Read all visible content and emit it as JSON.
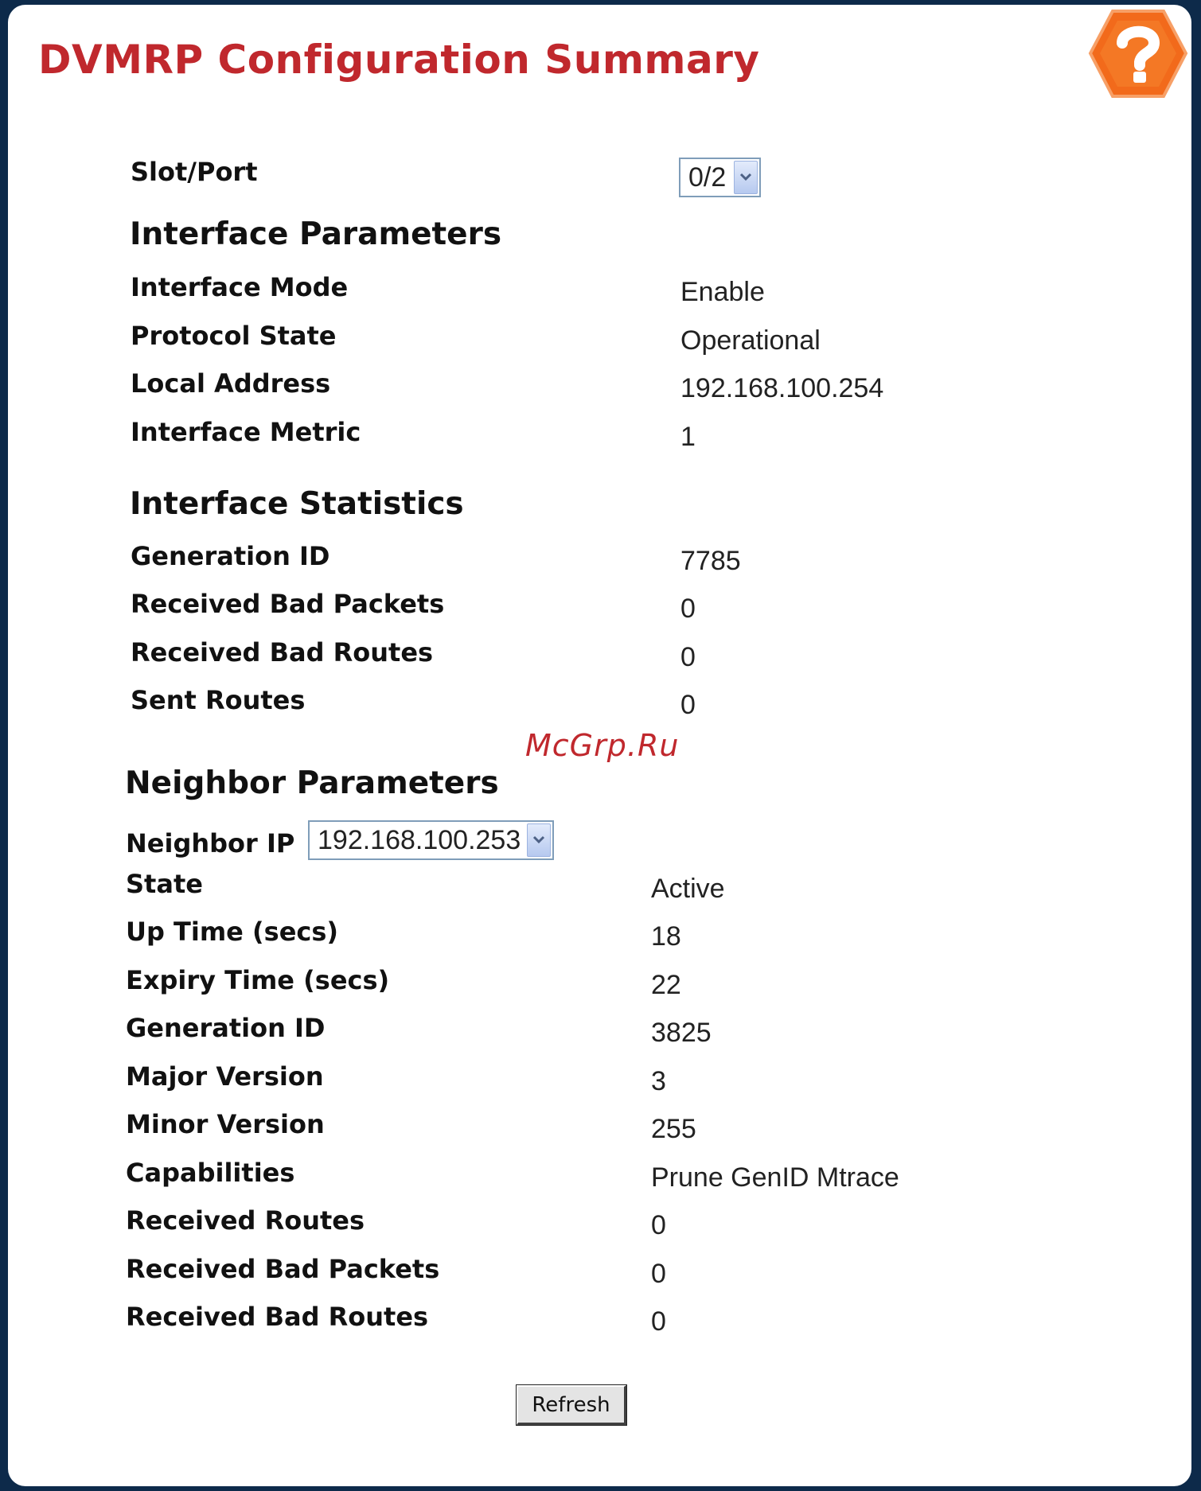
{
  "page": {
    "title": "DVMRP Configuration Summary"
  },
  "colors": {
    "title": "#c0282d",
    "help_icon": "#f26a1b",
    "frame": "#0d2a4a"
  },
  "icons": {
    "help": "question-mark-hexagon-icon",
    "dropdown": "chevron-down-icon"
  },
  "slot_port": {
    "label": "Slot/Port",
    "selected": "0/2"
  },
  "interface_parameters": {
    "heading": "Interface Parameters",
    "rows": [
      {
        "label": "Interface Mode",
        "value": "Enable"
      },
      {
        "label": "Protocol State",
        "value": "Operational"
      },
      {
        "label": "Local Address",
        "value": "192.168.100.254"
      },
      {
        "label": "Interface Metric",
        "value": "1"
      }
    ]
  },
  "interface_statistics": {
    "heading": "Interface Statistics",
    "rows": [
      {
        "label": "Generation ID",
        "value": "7785"
      },
      {
        "label": "Received Bad Packets",
        "value": "0"
      },
      {
        "label": "Received Bad Routes",
        "value": "0"
      },
      {
        "label": "Sent Routes",
        "value": "0"
      }
    ]
  },
  "watermark": "McGrp.Ru",
  "neighbor_parameters": {
    "heading": "Neighbor Parameters",
    "neighbor_ip": {
      "label": "Neighbor IP",
      "selected": "192.168.100.253"
    },
    "rows": [
      {
        "label": "State",
        "value": "Active"
      },
      {
        "label": "Up Time (secs)",
        "value": "18"
      },
      {
        "label": "Expiry Time (secs)",
        "value": "22"
      },
      {
        "label": "Generation ID",
        "value": "3825"
      },
      {
        "label": "Major Version",
        "value": "3"
      },
      {
        "label": "Minor Version",
        "value": "255"
      },
      {
        "label": "Capabilities",
        "value": "Prune GenID Mtrace"
      },
      {
        "label": "Received Routes",
        "value": "0"
      },
      {
        "label": "Received Bad Packets",
        "value": "0"
      },
      {
        "label": "Received Bad Routes",
        "value": "0"
      }
    ]
  },
  "actions": {
    "refresh_label": "Refresh"
  }
}
